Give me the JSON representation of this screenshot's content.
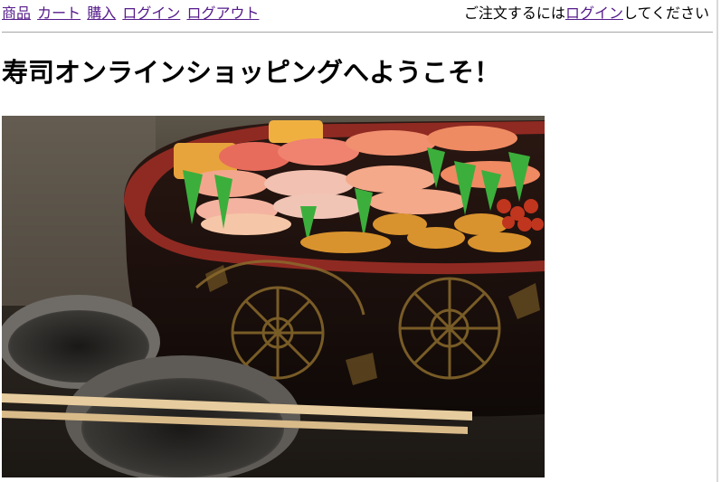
{
  "nav": {
    "links": [
      "商品",
      "カート",
      "購入",
      "ログイン",
      "ログアウト"
    ],
    "login_prefix": "ご注文するには",
    "login_link": "ログイン",
    "login_suffix": "してください"
  },
  "page": {
    "title": "寿司オンラインショッピングへようこそ！"
  },
  "colors": {
    "link": "#551a8b",
    "divider": "#a6a6a6"
  }
}
